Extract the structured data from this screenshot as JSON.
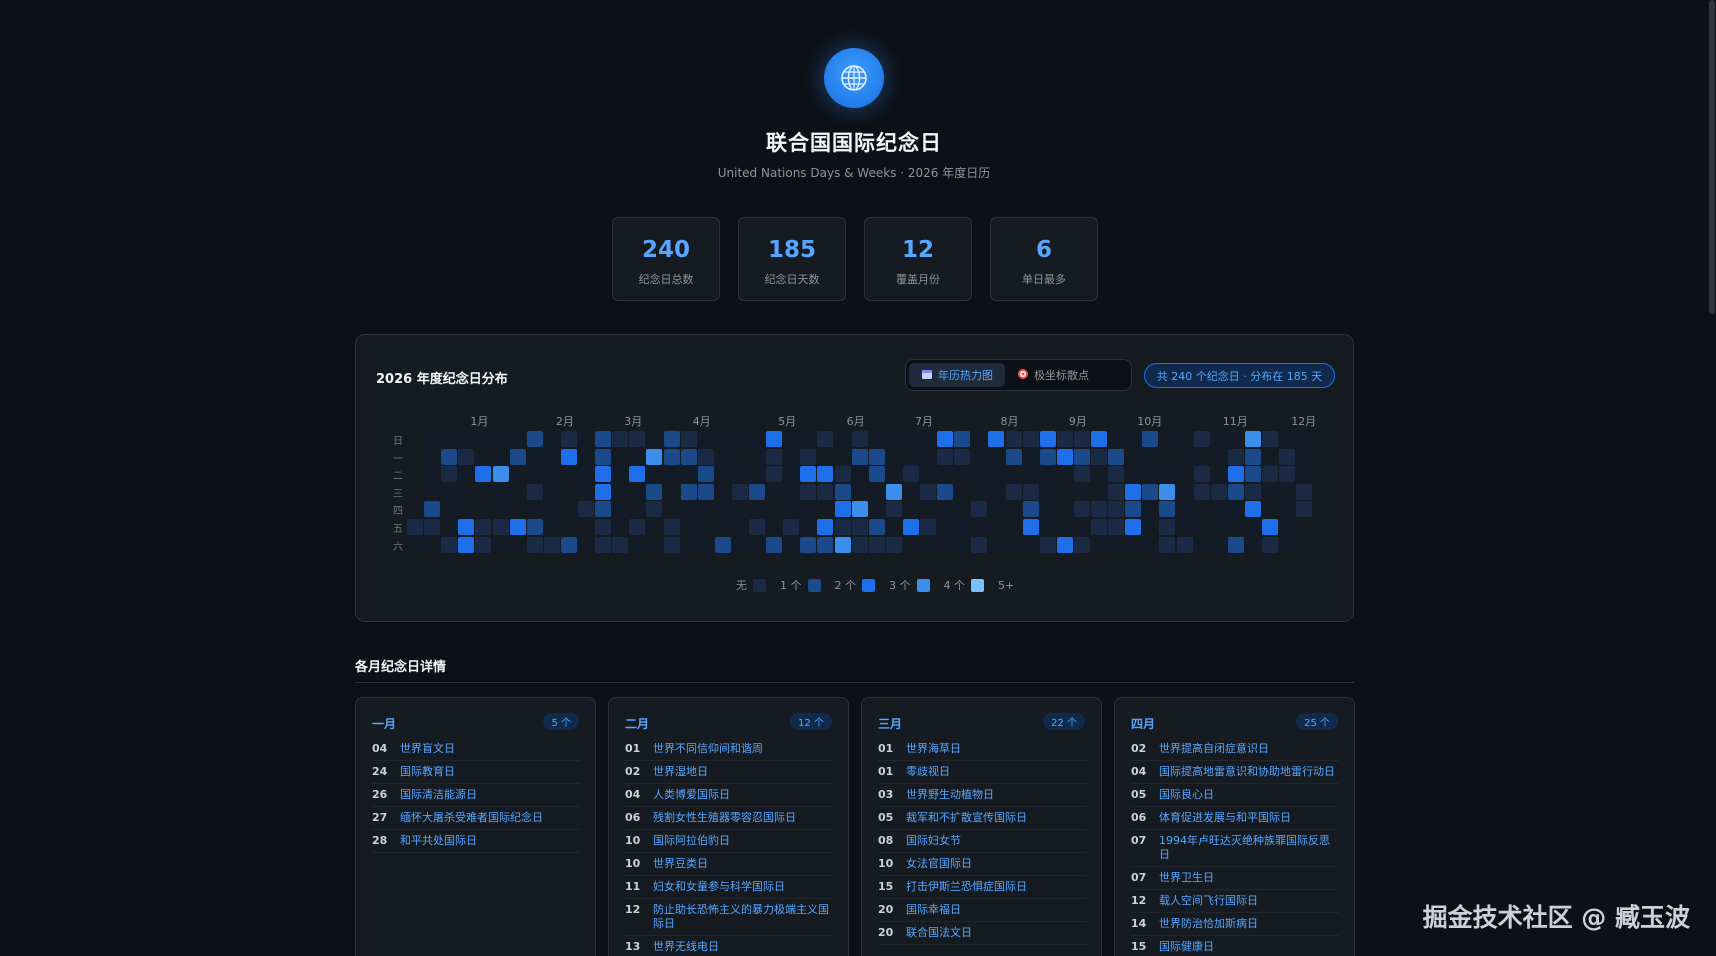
{
  "header": {
    "title": "联合国国际纪念日",
    "subtitle": "United Nations Days & Weeks · 2026 年度日历"
  },
  "stats": [
    {
      "value": "240",
      "label": "纪念日总数"
    },
    {
      "value": "185",
      "label": "纪念日天数"
    },
    {
      "value": "12",
      "label": "覆盖月份"
    },
    {
      "value": "6",
      "label": "单日最多"
    }
  ],
  "heatmap": {
    "title": "2026 年度纪念日分布",
    "view_heatmap": "年历热力图",
    "view_polar": "极坐标散点",
    "summary": "共 240 个纪念日 · 分布在 185 天",
    "months": [
      "1月",
      "2月",
      "3月",
      "4月",
      "5月",
      "6月",
      "7月",
      "8月",
      "9月",
      "10月",
      "11月",
      "12月"
    ],
    "weekdays": [
      "日",
      "一",
      "二",
      "三",
      "四",
      "五",
      "六"
    ],
    "legend": [
      "无",
      "1 个",
      "2 个",
      "3 个",
      "4 个",
      "5+"
    ],
    "colors": [
      "#1b2a44",
      "#1a4a8a",
      "#1f6feb",
      "#3b8eea",
      "#79c0ff"
    ]
  },
  "details": {
    "section_title": "各月纪念日详情",
    "months": [
      {
        "name": "一月",
        "count": "5 个",
        "items": [
          {
            "day": "04",
            "name": "世界盲文日"
          },
          {
            "day": "24",
            "name": "国际教育日"
          },
          {
            "day": "26",
            "name": "国际清洁能源日"
          },
          {
            "day": "27",
            "name": "缅怀大屠杀受难者国际纪念日"
          },
          {
            "day": "28",
            "name": "和平共处国际日"
          }
        ]
      },
      {
        "name": "二月",
        "count": "12 个",
        "items": [
          {
            "day": "01",
            "name": "世界不同信仰间和谐周"
          },
          {
            "day": "02",
            "name": "世界湿地日"
          },
          {
            "day": "04",
            "name": "人类博爱国际日"
          },
          {
            "day": "06",
            "name": "残割女性生殖器零容忍国际日"
          },
          {
            "day": "10",
            "name": "国际阿拉伯豹日"
          },
          {
            "day": "10",
            "name": "世界豆类日"
          },
          {
            "day": "11",
            "name": "妇女和女童参与科学国际日"
          },
          {
            "day": "12",
            "name": "防止助长恐怖主义的暴力极端主义国际日"
          },
          {
            "day": "13",
            "name": "世界无线电日"
          }
        ]
      },
      {
        "name": "三月",
        "count": "22 个",
        "items": [
          {
            "day": "01",
            "name": "世界海草日"
          },
          {
            "day": "01",
            "name": "零歧视日"
          },
          {
            "day": "03",
            "name": "世界野生动植物日"
          },
          {
            "day": "05",
            "name": "裁军和不扩散宣传国际日"
          },
          {
            "day": "08",
            "name": "国际妇女节"
          },
          {
            "day": "10",
            "name": "女法官国际日"
          },
          {
            "day": "15",
            "name": "打击伊斯兰恐惧症国际日"
          },
          {
            "day": "20",
            "name": "国际幸福日"
          },
          {
            "day": "20",
            "name": "联合国法文日"
          }
        ]
      },
      {
        "name": "四月",
        "count": "25 个",
        "items": [
          {
            "day": "02",
            "name": "世界提高自闭症意识日"
          },
          {
            "day": "04",
            "name": "国际提高地雷意识和协助地雷行动日"
          },
          {
            "day": "05",
            "name": "国际良心日"
          },
          {
            "day": "06",
            "name": "体育促进发展与和平国际日"
          },
          {
            "day": "07",
            "name": "1994年卢旺达灭绝种族罪国际反思日"
          },
          {
            "day": "07",
            "name": "世界卫生日"
          },
          {
            "day": "12",
            "name": "载人空间飞行国际日"
          },
          {
            "day": "14",
            "name": "世界防治恰加斯病日"
          },
          {
            "day": "15",
            "name": "国际健康日"
          }
        ]
      }
    ]
  },
  "watermark": "掘金技术社区 @ 臧玉波"
}
